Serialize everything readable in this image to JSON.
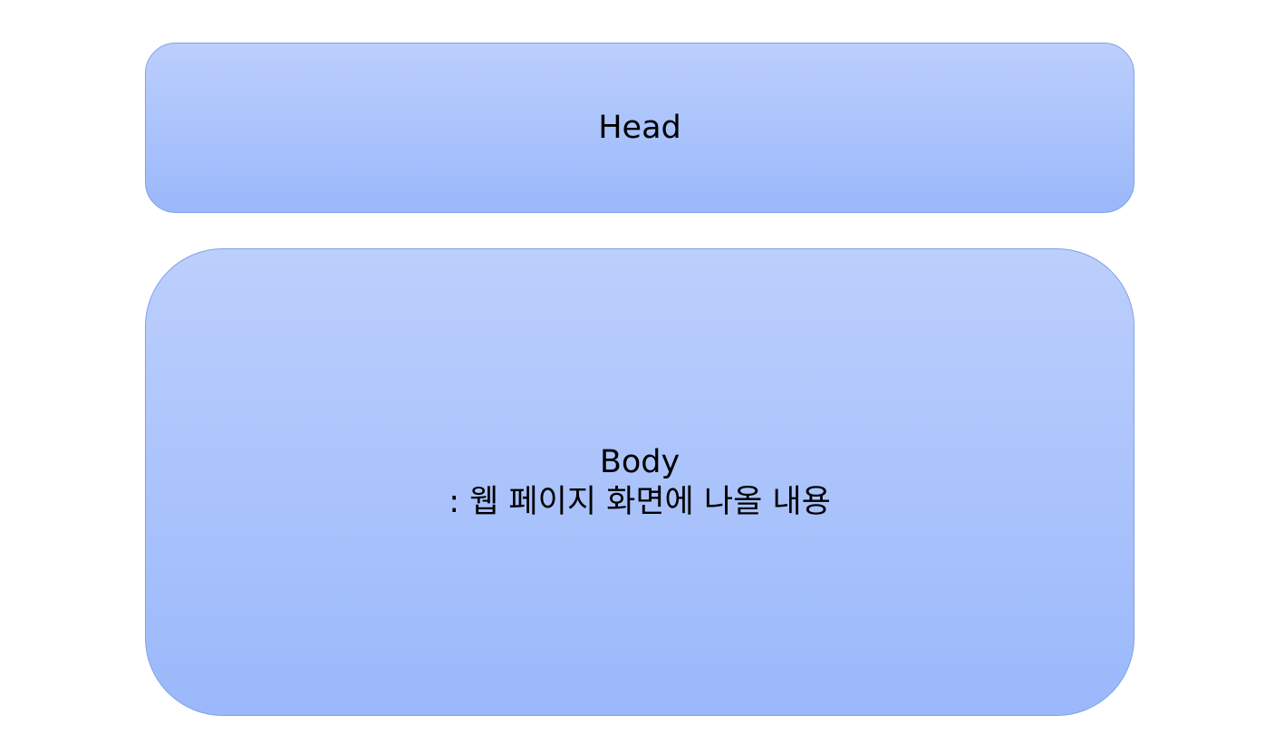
{
  "diagram": {
    "head": {
      "label": "Head"
    },
    "body": {
      "label": "Body",
      "description": ": 웹 페이지 화면에 나올 내용"
    }
  }
}
